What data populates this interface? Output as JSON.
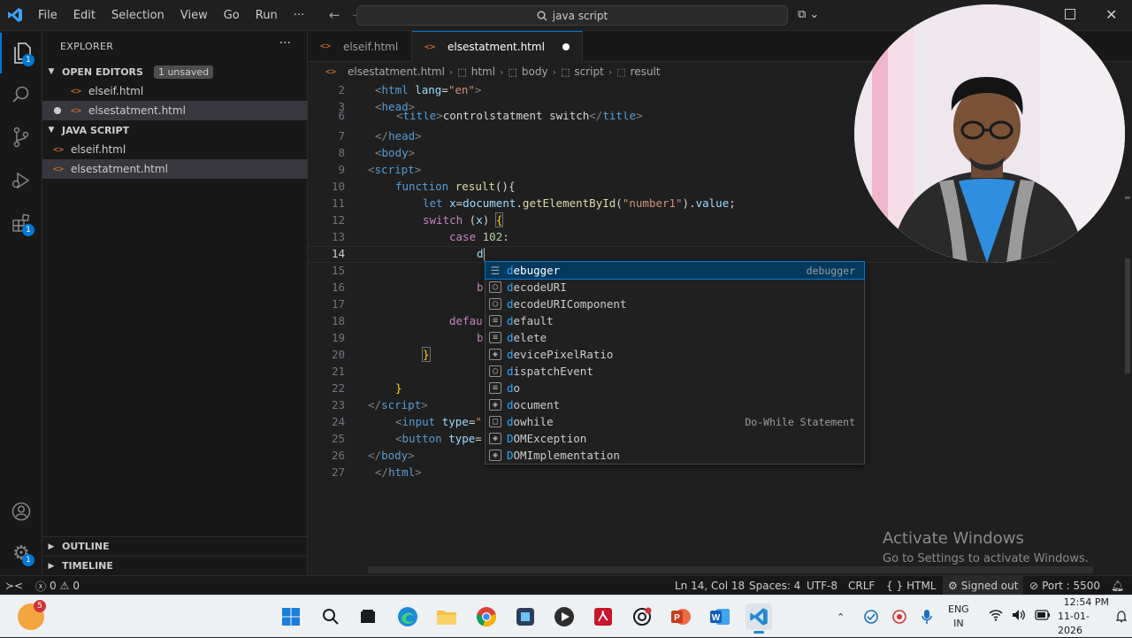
{
  "titlebar": {
    "menus": [
      "File",
      "Edit",
      "Selection",
      "View",
      "Go",
      "Run"
    ],
    "more": "···",
    "search_text": "java script"
  },
  "sidebar": {
    "header": "EXPLORER",
    "more": "···",
    "open_editors": {
      "title": "OPEN EDITORS",
      "badge": "1 unsaved",
      "files": [
        "elseif.html",
        "elsestatment.html"
      ]
    },
    "workspace": {
      "title": "JAVA SCRIPT",
      "files": [
        "elseif.html",
        "elsestatment.html"
      ]
    },
    "outline": "OUTLINE",
    "timeline": "TIMELINE"
  },
  "activity_badges": {
    "explorer": "1",
    "extensions": "1",
    "manage": "1"
  },
  "tabs": [
    {
      "label": "elseif.html"
    },
    {
      "label": "elsestatment.html"
    }
  ],
  "breadcrumb": [
    "elsestatment.html",
    "html",
    "body",
    "script",
    "result"
  ],
  "editor": {
    "line_numbers": [
      "2",
      "3",
      "6",
      "7",
      "8",
      "9",
      "10",
      "11",
      "12",
      "13",
      "14",
      "15",
      "16",
      "17",
      "18",
      "19",
      "20",
      "21",
      "22",
      "23",
      "24",
      "25",
      "26",
      "27"
    ],
    "current_line": "14"
  },
  "suggest": {
    "items": [
      {
        "label": "debugger",
        "kind": "snippet",
        "detail": "debugger"
      },
      {
        "label": "decodeURI",
        "kind": "function",
        "detail": ""
      },
      {
        "label": "decodeURIComponent",
        "kind": "function",
        "detail": ""
      },
      {
        "label": "default",
        "kind": "keyword",
        "detail": ""
      },
      {
        "label": "delete",
        "kind": "keyword",
        "detail": ""
      },
      {
        "label": "devicePixelRatio",
        "kind": "variable",
        "detail": ""
      },
      {
        "label": "dispatchEvent",
        "kind": "function",
        "detail": ""
      },
      {
        "label": "do",
        "kind": "keyword",
        "detail": ""
      },
      {
        "label": "document",
        "kind": "variable",
        "detail": ""
      },
      {
        "label": "dowhile",
        "kind": "snippet",
        "detail": "Do-While Statement"
      },
      {
        "label": "DOMException",
        "kind": "variable",
        "detail": ""
      },
      {
        "label": "DOMImplementation",
        "kind": "variable",
        "detail": ""
      }
    ]
  },
  "watermark": {
    "line1": "Activate Windows",
    "line2": "Go to Settings to activate Windows."
  },
  "statusbar": {
    "problems": "0",
    "warnings": "0",
    "position": "Ln 14, Col 18",
    "spaces": "Spaces: 4",
    "encoding": "UTF-8",
    "eol": "CRLF",
    "language": "HTML",
    "account": "Signed out",
    "port": "Port : 5500"
  },
  "taskbar": {
    "notification_count": "5",
    "language": "ENG",
    "region": "IN",
    "time": "12:54 PM",
    "date": "11-01-2026"
  },
  "colors": {
    "accent": "#0078d4",
    "editor_bg": "#1f1f1f",
    "html_icon": "#e37933"
  }
}
